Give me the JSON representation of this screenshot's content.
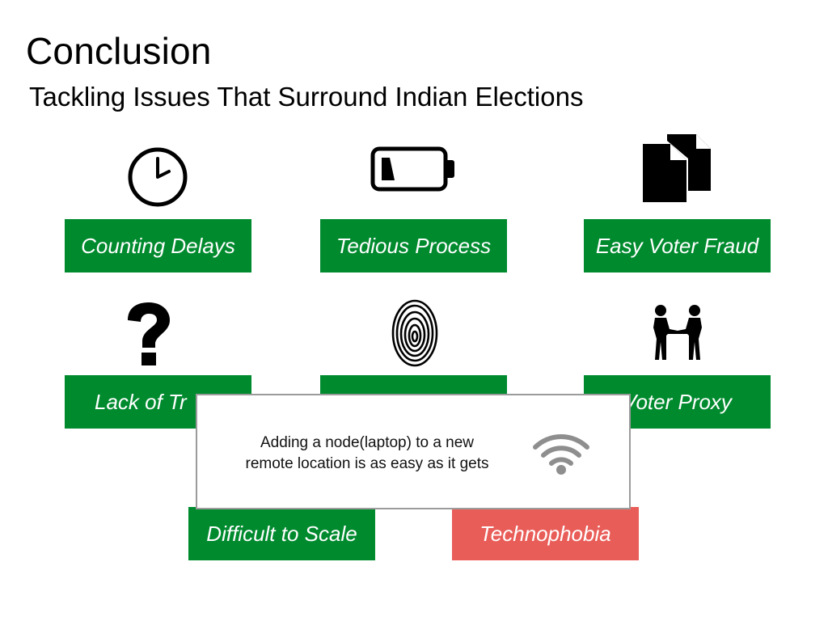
{
  "slide": {
    "title": "Conclusion",
    "subtitle": "Tackling Issues That Surround Indian Elections"
  },
  "issues": [
    {
      "label": "Counting Delays",
      "icon": "clock-icon",
      "color": "#008a2e"
    },
    {
      "label": "Tedious Process",
      "icon": "low-battery-icon",
      "color": "#008a2e"
    },
    {
      "label": "Easy Voter Fraud",
      "icon": "documents-icon",
      "color": "#008a2e"
    },
    {
      "label": "Lack of Tr",
      "icon": "question-mark-icon",
      "color": "#008a2e"
    },
    {
      "label": "",
      "icon": "fingerprint-icon",
      "color": "#008a2e"
    },
    {
      "label": "Voter Proxy",
      "icon": "handshake-icon",
      "color": "#008a2e"
    },
    {
      "label": "Difficult to Scale",
      "color": "#008a2e"
    },
    {
      "label": "Technophobia",
      "color": "#e95d58"
    }
  ],
  "popup": {
    "line1": "Adding a node(laptop) to a new",
    "line2": "remote location is as easy as it gets",
    "icon": "wifi-icon"
  }
}
